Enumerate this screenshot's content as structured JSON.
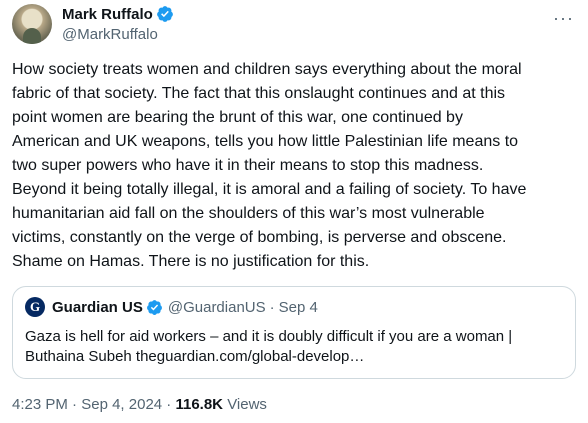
{
  "author": {
    "display_name": "Mark Ruffalo",
    "handle": "@MarkRuffalo",
    "more_icon": "more-horizontal-icon",
    "verified_color": "#1d9bf0"
  },
  "tweet": {
    "text": "How society treats women and children says everything about the moral\nfabric of that society. The fact that this onslaught continues and at this\npoint women are bearing the brunt of this war, one continued by\nAmerican and UK weapons, tells you how little Palestinian life means to\ntwo super powers who have it in their means to stop this madness.\nBeyond it being totally illegal, it is amoral and a failing of society. To have\nhumanitarian aid fall on the shoulders of this war’s most vulnerable\nvictims, constantly on the verge of bombing, is perverse and obscene.\nShame on Hamas. There is no justification for this."
  },
  "quote": {
    "logo_letter": "G",
    "display_name": "Guardian US",
    "handle": "@GuardianUS",
    "separator": "·",
    "date": "Sep 4",
    "text": "Gaza is hell for aid workers – and it is doubly difficult if you are a woman |\nButhaina Subeh theguardian.com/global-develop…"
  },
  "footer": {
    "time": "4:23 PM",
    "separator": "·",
    "date": "Sep 4, 2024",
    "separator2": "·",
    "views_count": "116.8K",
    "views_label": "Views"
  }
}
